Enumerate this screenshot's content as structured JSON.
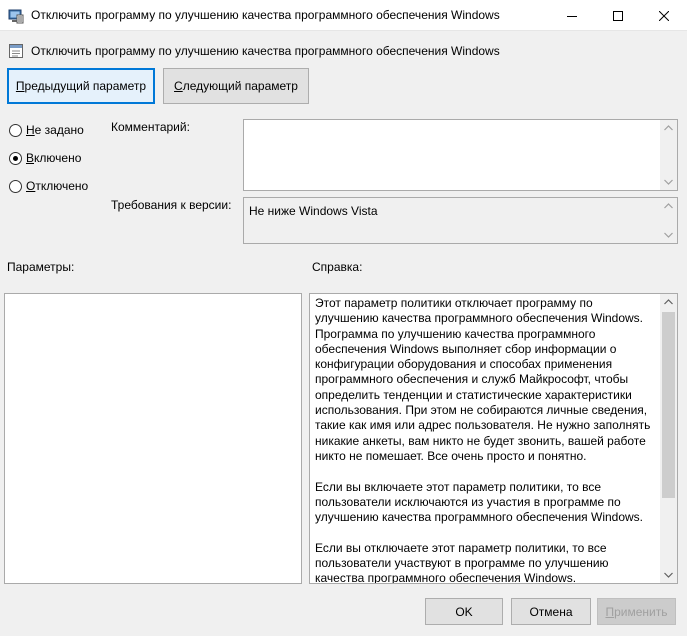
{
  "window": {
    "title": "Отключить программу по улучшению качества программного обеспечения Windows",
    "icons": {
      "app": "policy-editor-icon",
      "minimize": "minimize-icon",
      "maximize": "maximize-icon",
      "close": "close-icon"
    }
  },
  "header": {
    "policy_name": "Отключить программу по улучшению качества программного обеспечения Windows",
    "policy_icon": "policy-setting-icon"
  },
  "nav": {
    "prev": {
      "acc": "П",
      "rest": "редыдущий параметр"
    },
    "next": {
      "acc": "С",
      "rest": "ледующий параметр"
    }
  },
  "options": [
    {
      "acc": "Н",
      "rest": "е задано",
      "checked": false
    },
    {
      "acc": "В",
      "rest": "ключено",
      "checked": true
    },
    {
      "acc": "О",
      "rest": "тключено",
      "checked": false
    }
  ],
  "comment": {
    "label": "Комментарий:",
    "value": ""
  },
  "requirements": {
    "label": "Требования к версии:",
    "value": "Не ниже Windows Vista"
  },
  "params_label": "Параметры:",
  "help": {
    "label": "Справка:",
    "paragraphs": [
      "Этот параметр политики отключает программу по улучшению качества программного обеспечения Windows. Программа по улучшению качества программного обеспечения Windows выполняет сбор информации о конфигурации оборудования и способах применения программного обеспечения и служб Майкрософт, чтобы определить тенденции и статистические характеристики использования. При этом не собираются личные сведения, такие как имя или адрес пользователя. Не нужно заполнять никакие анкеты, вам никто не будет звонить, вашей работе никто не помешает. Все очень просто и понятно.",
      "Если вы включаете этот параметр политики, то все пользователи исключаются из участия в программе по улучшению качества программного обеспечения Windows.",
      "Если вы отключаете этот параметр политики, то все пользователи участвуют в программе по улучшению качества программного обеспечения Windows."
    ]
  },
  "footer": {
    "ok": "OK",
    "cancel": "Отмена",
    "apply": {
      "acc": "П",
      "rest": "рименить"
    }
  },
  "colors": {
    "focus_border": "#0078d7",
    "background": "#f0f0f0"
  }
}
